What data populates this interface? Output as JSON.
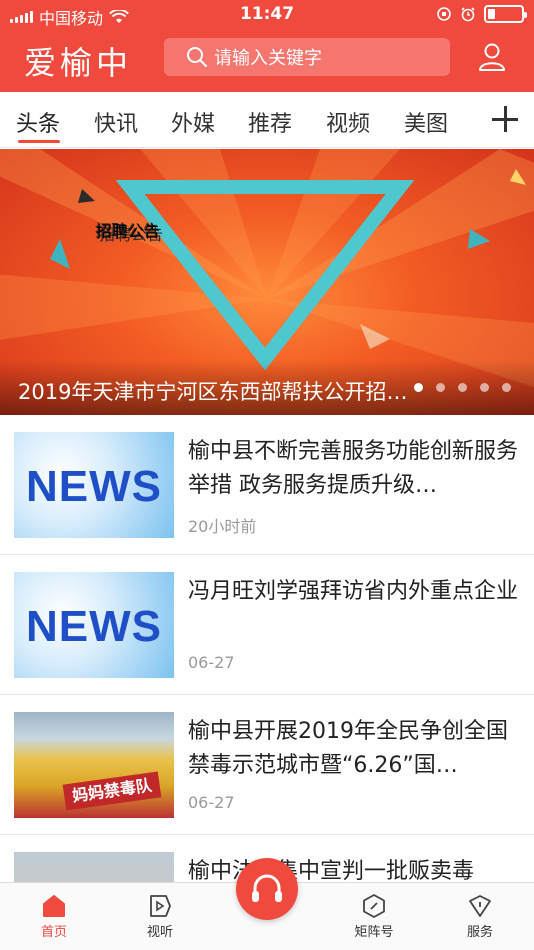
{
  "status_bar": {
    "carrier": "中国移动",
    "time": "11:47"
  },
  "header": {
    "logo": "爱榆中",
    "search_placeholder": "请输入关键字"
  },
  "tabs": [
    {
      "label": "头条"
    },
    {
      "label": "快讯"
    },
    {
      "label": "外媒"
    },
    {
      "label": "推荐"
    },
    {
      "label": "视频"
    },
    {
      "label": "美图"
    }
  ],
  "banner": {
    "headline": "招聘公告",
    "caption": "2019年天津市宁河区东西部帮扶公开招…",
    "page_count": 5,
    "active_page": 1
  },
  "news": [
    {
      "thumb_text": "NEWS",
      "title": "榆中县不断完善服务功能创新服务举措 政务服务提质升级…",
      "time": "20小时前"
    },
    {
      "thumb_text": "NEWS",
      "title": "冯月旺刘学强拜访省内外重点企业",
      "time": "06-27"
    },
    {
      "thumb_text": "妈妈禁毒队",
      "title": "榆中县开展2019年全民争创全国禁毒示范城市暨“6.26”国…",
      "time": "06-27"
    },
    {
      "thumb_text": "",
      "title": "榆中法院集中宣判一批贩卖毒",
      "time": ""
    }
  ],
  "bottom_nav": [
    {
      "label": "首页"
    },
    {
      "label": "视听"
    },
    {
      "label": "矩阵号"
    },
    {
      "label": "服务"
    }
  ],
  "colors": {
    "brand": "#f0493e",
    "inactive_text": "#333333",
    "meta_text": "#9a9a9a"
  }
}
